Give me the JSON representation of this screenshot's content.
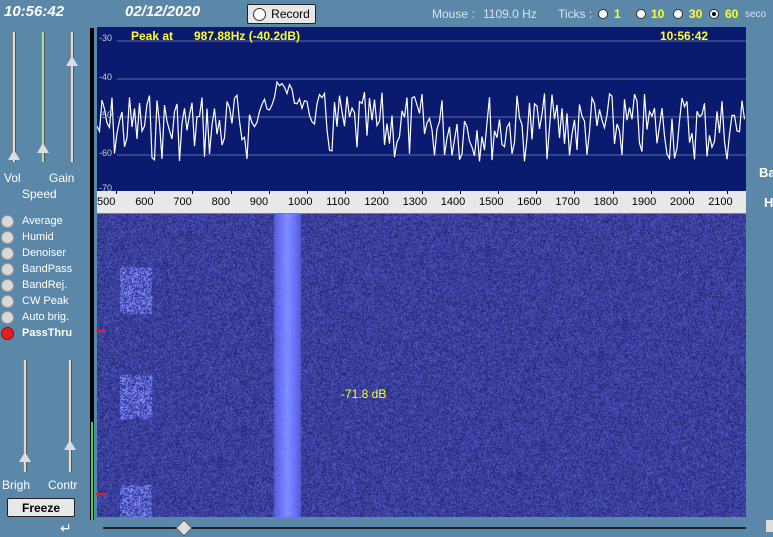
{
  "header": {
    "time": "10:56:42",
    "date": "02/12/2020",
    "record_label": "Record",
    "mouse_label": "Mouse :",
    "mouse_value": "1109.0 Hz",
    "ticks_label": "Ticks :",
    "ticks_options": [
      "1",
      "10",
      "30",
      "60"
    ],
    "ticks_selected": "60",
    "seconds_label": "seco"
  },
  "left_panel": {
    "vol_label": "Vol",
    "gain_label": "Gain",
    "speed_label": "Speed",
    "modes": [
      "Average",
      "Humid",
      "Denoiser",
      "BandPass",
      "BandRej.",
      "CW Peak",
      "Auto brig.",
      "PassThru"
    ],
    "active_mode": "PassThru",
    "brigh_label": "Brigh",
    "contr_label": "Contr",
    "freeze_label": "Freeze"
  },
  "spectrum": {
    "peak_label": "Peak at",
    "peak_value": "987.88Hz (-40.2dB)",
    "time": "10:56:42",
    "db_ticks": [
      "-30",
      "-40",
      "-50",
      "-60",
      "-70"
    ],
    "freq_ticks": [
      "500",
      "600",
      "700",
      "800",
      "900",
      "1000",
      "1100",
      "1200",
      "1300",
      "1400",
      "1500",
      "1600",
      "1700",
      "1800",
      "1900",
      "2000",
      "2100",
      "2"
    ]
  },
  "waterfall": {
    "level_readout": "-71.8 dB"
  },
  "right_panel": {
    "label_b": "Ba",
    "label_h": "H"
  },
  "colors": {
    "background": "#5b87a8",
    "spectrum_bg": "#0a1a6e",
    "waterfall_bg": "#1a2a7a",
    "accent_text": "#ffff30"
  }
}
